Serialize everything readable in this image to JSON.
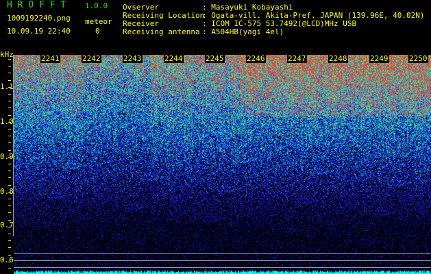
{
  "app": {
    "title": "H R O F F T",
    "version": "1.0.0"
  },
  "file": {
    "name": "1009192240.png",
    "datetime": "10.09.19 22:40"
  },
  "meteor": {
    "label": "meteor",
    "count": "0"
  },
  "info": [
    {
      "label": "Ovserver",
      "value": ": Masayuki Kobayashi"
    },
    {
      "label": "Receiving Location",
      "value": ": Ogata-vill. Akita-Pref. JAPAN (139.96E, 40.02N)"
    },
    {
      "label": "Receiver",
      "value": ": ICOM IC-575 53.7492(@LCD)MHz USB"
    },
    {
      "label": "Receiving antenna",
      "value": ": A504HB(yagi 4el)"
    }
  ],
  "axis": {
    "y_unit": "kHz",
    "y_ticks": [
      "1.1",
      "1.0",
      "0.9",
      "0.8",
      "0.7",
      "0.6"
    ],
    "x_ticks": [
      "2241",
      "2242",
      "2243",
      "2244",
      "2245",
      "2246",
      "2247",
      "2248",
      "2249",
      "2250"
    ]
  },
  "colors": {
    "text": "#ffff00",
    "title": "#22dd22",
    "level_bar": "#00ffff",
    "reference_line": "#9a9a9a"
  }
}
